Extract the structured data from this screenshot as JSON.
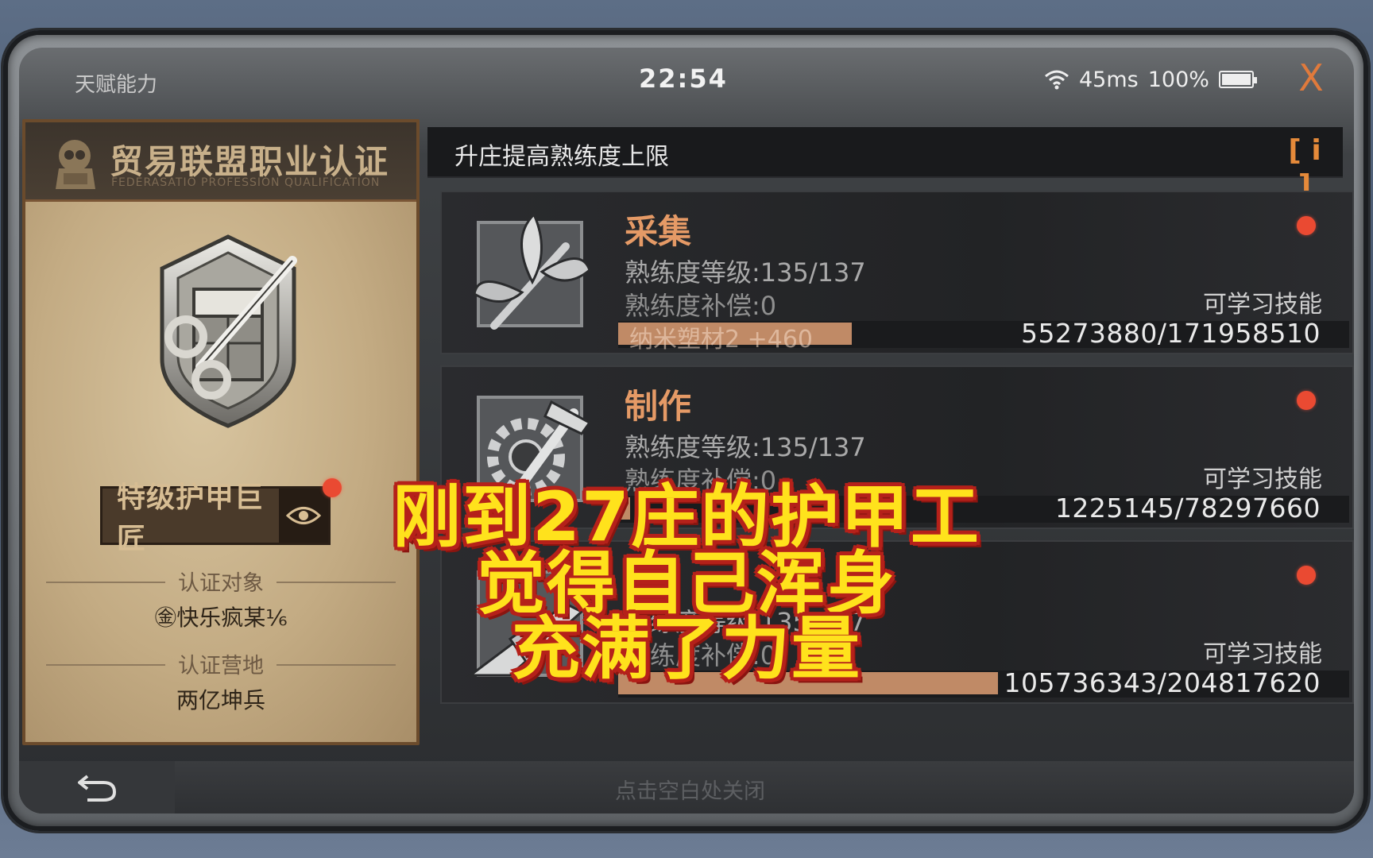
{
  "window": {
    "title": "天赋能力",
    "clock": "22:54",
    "ping": "45ms",
    "battery": "100%",
    "close_glyph": "X"
  },
  "certificate": {
    "title": "贸易联盟职业认证",
    "subtitle": "FEDERASATIO PROFESSION QUALIFICATION",
    "rank": "特级护甲巨匠",
    "target_label": "认证对象",
    "target_value": "㊎快乐疯某⅙",
    "camp_label": "认证营地",
    "camp_value": "两亿坤兵"
  },
  "skills_panel": {
    "header": "升庄提高熟练度上限",
    "info_glyph": "[ i ]"
  },
  "skills": [
    {
      "name": "采集",
      "level": "熟练度等级:135/137",
      "compensation": "熟练度补偿:0",
      "learnable_label": "可学习技能",
      "progress_text": "55273880/171958510",
      "progress_fraction": 0.32,
      "floating_text": "纳米塑材2 +460",
      "icon": "gather-leaf-icon"
    },
    {
      "name": "制作",
      "level": "熟练度等级:135/137",
      "compensation": "熟练度补偿:0",
      "learnable_label": "可学习技能",
      "progress_text": "1225145/78297660",
      "progress_fraction": 0.016,
      "icon": "craft-hammer-icon"
    },
    {
      "name": "",
      "level": "熟练度等级:135/137",
      "compensation": "熟练度补偿:0",
      "learnable_label": "可学习技能",
      "progress_text": "105736343/204817620",
      "progress_fraction": 0.52,
      "icon": "combat-gun-icon"
    }
  ],
  "footer": {
    "close_hint": "点击空白处关闭",
    "back_icon": "back-arrow-icon"
  },
  "caption": {
    "line1": "刚到27庄的护甲工",
    "line2": "觉得自己浑身",
    "line3": "充满了力量"
  },
  "colors": {
    "accent_orange": "#e07a3c",
    "skill_name": "#e59a66",
    "progress_fill": "#c08a66",
    "notify_dot": "#ea4a32",
    "caption_fill": "#ffe21c",
    "caption_outline": "#b5211a"
  }
}
